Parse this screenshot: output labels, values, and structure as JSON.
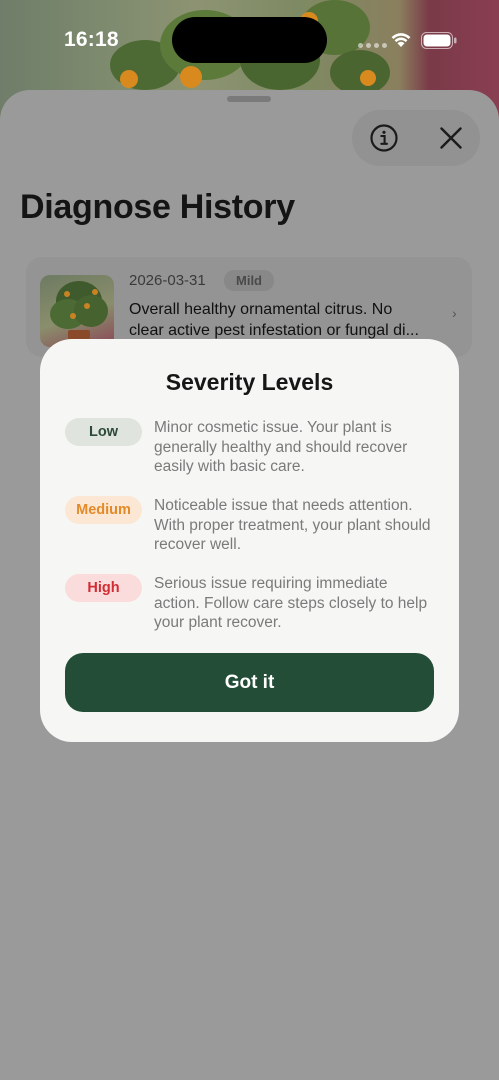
{
  "status_bar": {
    "time": "16:18"
  },
  "header": {
    "title": "Diagnose History",
    "info_icon": "info-icon",
    "close_icon": "close-icon"
  },
  "history": [
    {
      "date": "2026-03-31",
      "severity": "Mild",
      "description_line1": "Overall healthy ornamental citrus. No",
      "description_line2": "clear active pest infestation or fungal di...",
      "chevron_icon": "chevron-right-icon"
    }
  ],
  "modal": {
    "title": "Severity Levels",
    "levels": [
      {
        "label": "Low",
        "description": "Minor cosmetic issue. Your plant is generally healthy and should recover easily with basic care."
      },
      {
        "label": "Medium",
        "description": "Noticeable issue that needs attention. With proper treatment, your plant should recover well."
      },
      {
        "label": "High",
        "description": "Serious issue requiring immediate action. Follow care steps closely to help your plant recover."
      }
    ],
    "button_label": "Got it"
  },
  "colors": {
    "primary": "#244d38",
    "low": "#2d4a38",
    "medium": "#e48a28",
    "high": "#d12d35"
  }
}
